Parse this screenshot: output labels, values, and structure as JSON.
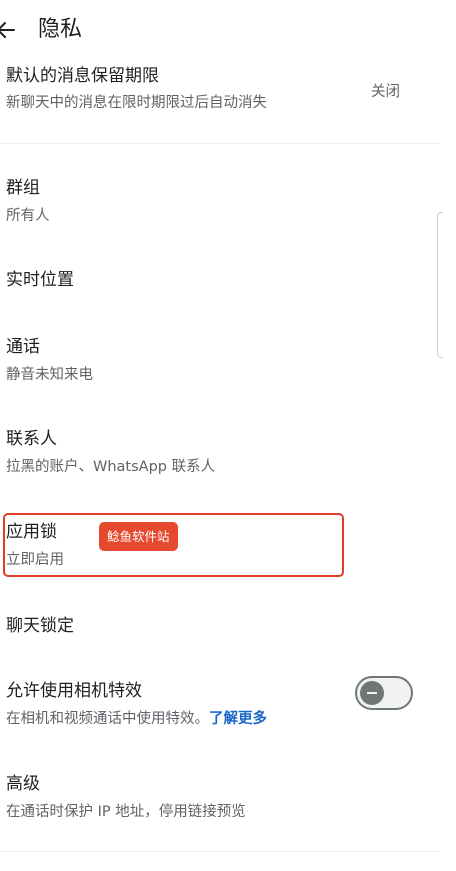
{
  "header": {
    "title": "隐私"
  },
  "rows": {
    "disappearing": {
      "title": "默认的消息保留期限",
      "subtitle": "新聊天中的消息在限时期限过后自动消失",
      "value": "关闭"
    },
    "groups": {
      "title": "群组",
      "subtitle": "所有人"
    },
    "live_location": {
      "title": "实时位置"
    },
    "calls": {
      "title": "通话",
      "subtitle": "静音未知来电"
    },
    "contacts": {
      "title": "联系人",
      "subtitle": "拉黑的账户、WhatsApp 联系人"
    },
    "app_lock": {
      "title": "应用锁",
      "subtitle": "立即启用"
    },
    "chat_lock": {
      "title": "聊天锁定"
    },
    "camera_effects": {
      "title": "允许使用相机特效",
      "subtitle": "在相机和视频通话中使用特效。",
      "link": "了解更多",
      "toggle_on": false
    },
    "advanced": {
      "title": "高级",
      "subtitle": "在通话时保护 IP 地址，停用链接预览"
    }
  },
  "watermark": "鲶鱼软件站",
  "colors": {
    "highlight": "#e23b28",
    "link": "#1b67c9",
    "watermark_bg": "#e54a2f"
  },
  "icons": {
    "back": "arrow-left"
  }
}
